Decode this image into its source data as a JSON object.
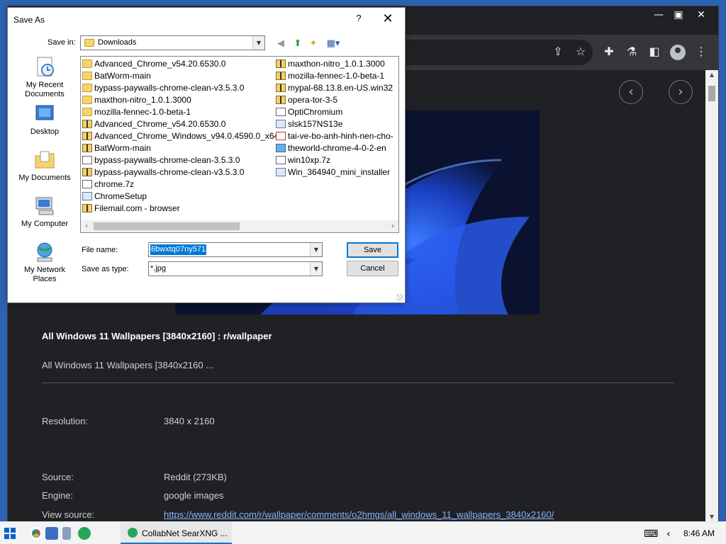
{
  "dialog": {
    "title": "Save As",
    "help": "?",
    "close": "✕",
    "save_in_label": "Save in:",
    "save_in_value": "Downloads",
    "file_name_label": "File name:",
    "file_name_value": "6bwxtq07ny571",
    "save_type_label": "Save as type:",
    "save_type_value": "*.jpg",
    "save_button": "Save",
    "cancel_button": "Cancel",
    "places": [
      {
        "label": "My Recent Documents",
        "icon": "recent-documents-icon"
      },
      {
        "label": "Desktop",
        "icon": "desktop-icon"
      },
      {
        "label": "My Documents",
        "icon": "my-documents-icon"
      },
      {
        "label": "My Computer",
        "icon": "my-computer-icon"
      },
      {
        "label": "My Network Places",
        "icon": "network-places-icon"
      }
    ],
    "files_col1": [
      {
        "name": "Advanced_Chrome_v54.20.6530.0",
        "type": "folder"
      },
      {
        "name": "BatWorm-main",
        "type": "folder"
      },
      {
        "name": "bypass-paywalls-chrome-clean-v3.5.3.0",
        "type": "folder"
      },
      {
        "name": "maxthon-nitro_1.0.1.3000",
        "type": "folder"
      },
      {
        "name": "mozilla-fennec-1.0-beta-1",
        "type": "folder"
      },
      {
        "name": "Advanced_Chrome_v54.20.6530.0",
        "type": "zip"
      },
      {
        "name": "Advanced_Chrome_Windows_v94.0.4590.0_x64",
        "type": "zip"
      },
      {
        "name": "BatWorm-main",
        "type": "zip"
      },
      {
        "name": "bypass-paywalls-chrome-clean-3.5.3.0",
        "type": "doc"
      },
      {
        "name": "bypass-paywalls-chrome-clean-v3.5.3.0",
        "type": "zip"
      },
      {
        "name": "chrome.7z",
        "type": "doc"
      },
      {
        "name": "ChromeSetup",
        "type": "exe"
      },
      {
        "name": "Filemail.com - browser",
        "type": "zip"
      }
    ],
    "files_col2": [
      {
        "name": "maxthon-nitro_1.0.1.3000",
        "type": "zip"
      },
      {
        "name": "mozilla-fennec-1.0-beta-1",
        "type": "zip"
      },
      {
        "name": "mypal-68.13.8.en-US.win32",
        "type": "zip"
      },
      {
        "name": "opera-tor-3-5",
        "type": "zip"
      },
      {
        "name": "OptiChromium",
        "type": "doc"
      },
      {
        "name": "slsk157NS13e",
        "type": "exe"
      },
      {
        "name": "tai-ve-bo-anh-hinh-nen-cho-",
        "type": "img"
      },
      {
        "name": "theworld-chrome-4-0-2-en",
        "type": "app"
      },
      {
        "name": "win10xp.7z",
        "type": "doc"
      },
      {
        "name": "Win_364940_mini_installer",
        "type": "exe"
      }
    ]
  },
  "browser": {
    "result_title": "All Windows 11 Wallpapers [3840x2160] : r/wallpaper",
    "result_desc": "All Windows 11 Wallpapers [3840x2160 ...",
    "resolution_label": "Resolution:",
    "resolution_value": "3840 x 2160",
    "source_label": "Source:",
    "source_value": "Reddit (273KB)",
    "engine_label": "Engine:",
    "engine_value": "google images",
    "view_source_label": "View source:",
    "view_source_url": "https://www.reddit.com/r/wallpaper/comments/o2hmgs/all_windows_11_wallpapers_3840x2160/"
  },
  "taskbar": {
    "task_label": "CollabNet SearXNG ...",
    "clock": "8:46 AM"
  }
}
